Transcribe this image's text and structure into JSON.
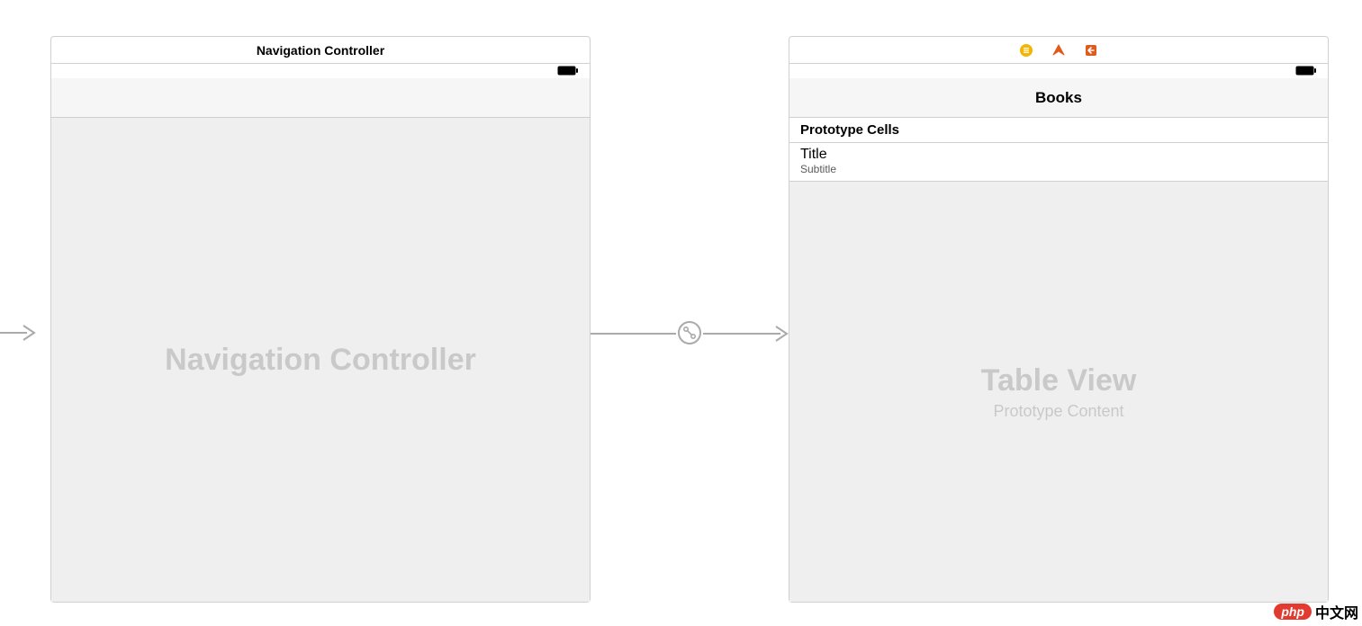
{
  "scene_left": {
    "title": "Navigation Controller",
    "placeholder": "Navigation Controller"
  },
  "scene_right": {
    "nav_title": "Books",
    "prototype_header": "Prototype Cells",
    "cell": {
      "title": "Title",
      "subtitle": "Subtitle"
    },
    "placeholder_title": "Table View",
    "placeholder_sub": "Prototype Content"
  },
  "watermark": {
    "brand": "php",
    "text": "中文网"
  },
  "icons": {
    "dock_vc": "view-controller-icon",
    "dock_first": "first-responder-icon",
    "dock_exit": "exit-icon",
    "battery": "battery-icon",
    "segue": "segue-icon"
  }
}
